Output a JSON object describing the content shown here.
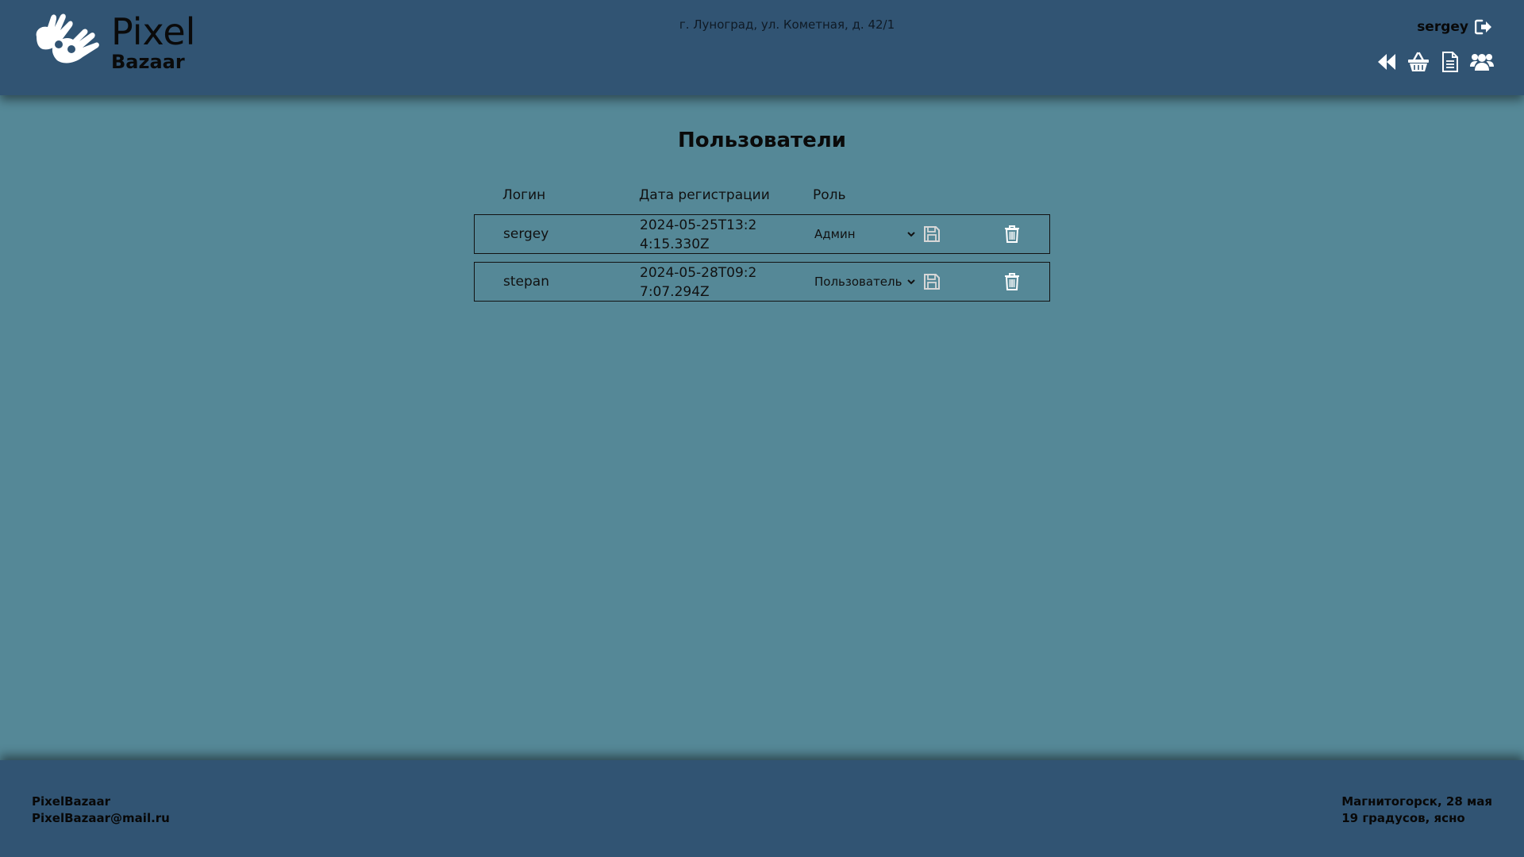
{
  "header": {
    "logo": {
      "line1": "Pixel",
      "line2": "Bazaar"
    },
    "address": "г. Луноград, ул. Кометная, д. 42/1",
    "user": {
      "name": "sergey",
      "logout_icon": "sign-out-icon"
    },
    "nav_icons": [
      "backward-icon",
      "basket-icon",
      "document-icon",
      "users-icon"
    ]
  },
  "main": {
    "title": "Пользователи",
    "columns": {
      "login": "Логин",
      "date": "Дата регистрации",
      "role": "Роль"
    },
    "rows": [
      {
        "login": "sergey",
        "date": "2024-05-25T13:24:15.330Z",
        "role": "Админ"
      },
      {
        "login": "stepan",
        "date": "2024-05-28T09:27:07.294Z",
        "role": "Пользователь"
      }
    ]
  },
  "footer": {
    "brand": "PixelBazaar",
    "email": "PixelBazaar@mail.ru",
    "weather_line1": "Магнитогорск, 28 мая",
    "weather_line2": "19 градусов, ясно"
  },
  "colors": {
    "header_bg": "#315473",
    "page_bg": "#558897",
    "icon": "#ffffff"
  }
}
